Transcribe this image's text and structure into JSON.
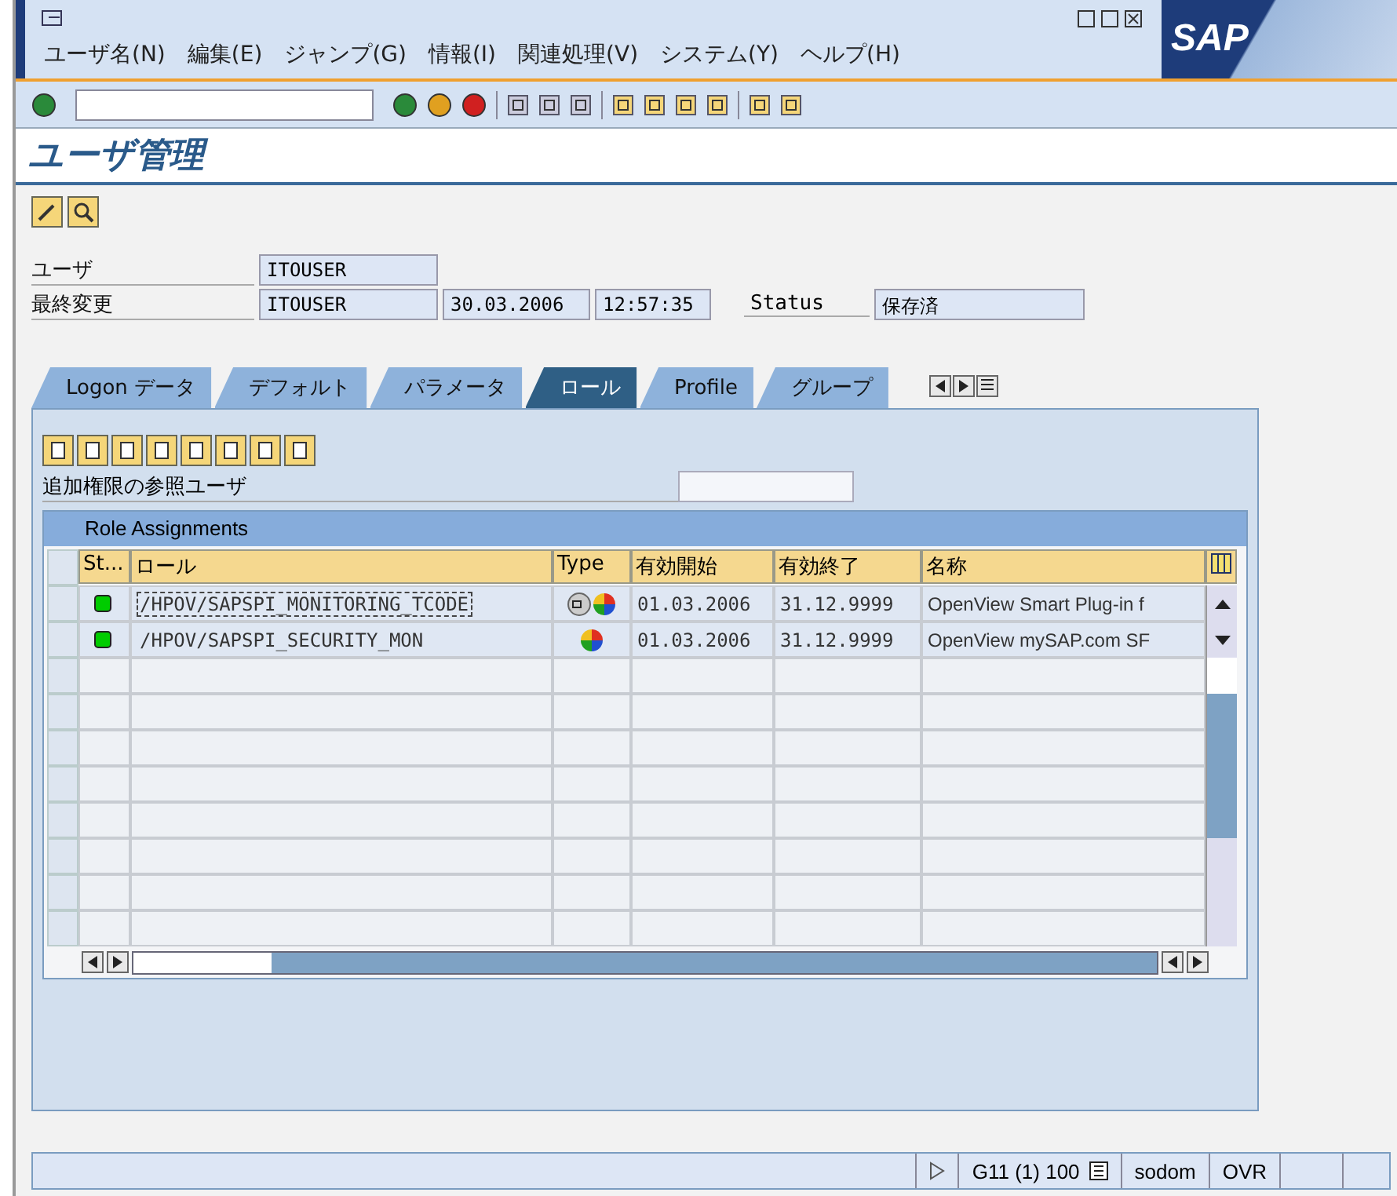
{
  "menu": [
    "ユーザ名(N)",
    "編集(E)",
    "ジャンプ(G)",
    "情報(I)",
    "関連処理(V)",
    "システム(Y)",
    "ヘルプ(H)"
  ],
  "logo": "SAP",
  "title": "ユーザ管理",
  "fields": {
    "user_label": "ユーザ",
    "user": "ITOUSER",
    "changed_label": "最終変更",
    "changed_by": "ITOUSER",
    "changed_date": "30.03.2006",
    "changed_time": "12:57:35",
    "status_label": "Status",
    "status": "保存済"
  },
  "tabs": [
    {
      "label": "Logon データ",
      "selected": false
    },
    {
      "label": "デフォルト",
      "selected": false
    },
    {
      "label": "パラメータ",
      "selected": false
    },
    {
      "label": "ロール",
      "selected": true
    },
    {
      "label": "Profile",
      "selected": false
    },
    {
      "label": "グループ",
      "selected": false
    }
  ],
  "reference_user_label": "追加権限の参照ユーザ",
  "table": {
    "title": "Role Assignments",
    "columns": [
      "St...",
      "ロール",
      "Type",
      "有効開始",
      "有効終了",
      "名称"
    ],
    "rows": [
      {
        "role": "/HPOV/SAPSPI_MONITORING_TCODE",
        "composite": true,
        "focused": true,
        "from": "01.03.2006",
        "to": "31.12.9999",
        "name": "OpenView Smart Plug-in f",
        "color": "#00cc00"
      },
      {
        "role": "/HPOV/SAPSPI_SECURITY_MON",
        "composite": false,
        "focused": false,
        "from": "01.03.2006",
        "to": "31.12.9999",
        "name": "OpenView mySAP.com SF",
        "color": "#00cc00"
      }
    ]
  },
  "status_bar": {
    "system": "G11 (1) 100",
    "server": "sodom",
    "mode": "OVR"
  }
}
